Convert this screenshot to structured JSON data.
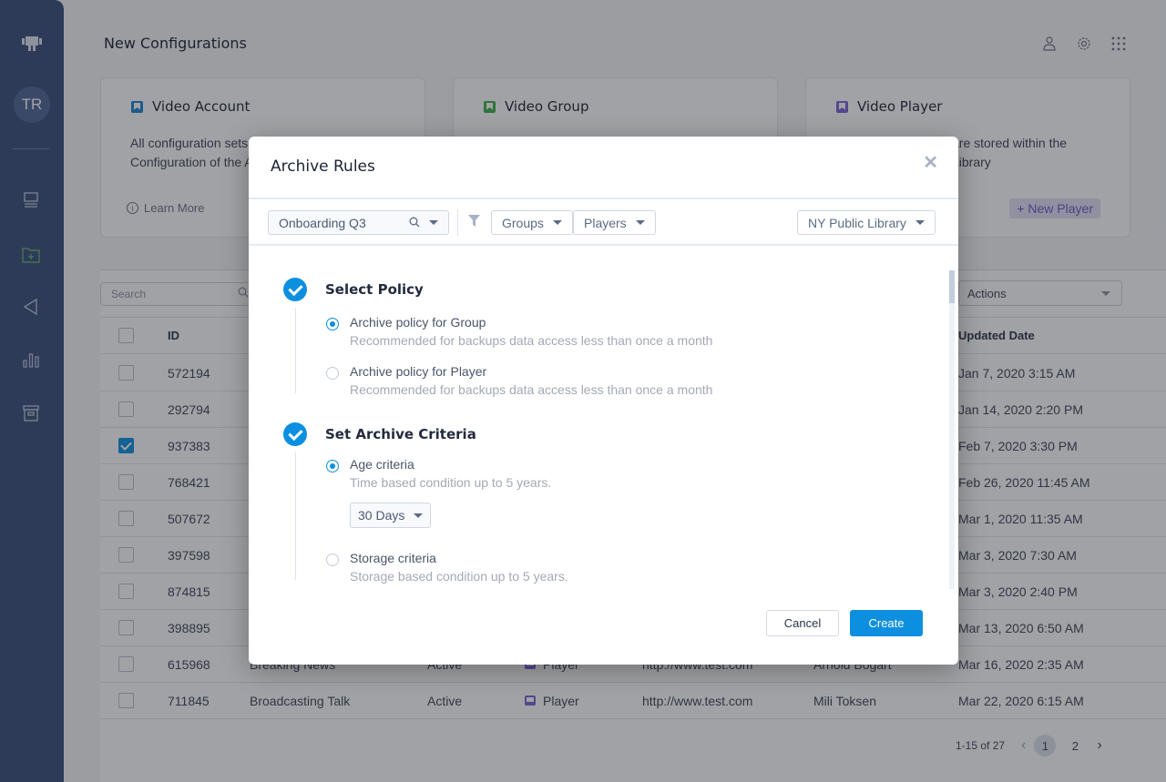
{
  "sidebar": {
    "avatar_initials": "TR",
    "items": [
      {
        "icon": "server-icon"
      },
      {
        "icon": "folder-add-icon"
      },
      {
        "icon": "send-icon"
      },
      {
        "icon": "bar-chart-icon"
      },
      {
        "icon": "archive-icon"
      }
    ]
  },
  "header": {
    "title": "New Configurations",
    "icons": [
      "user-icon",
      "gear-icon",
      "apps-grid-icon"
    ]
  },
  "cards": [
    {
      "title": "Video Account",
      "color": "#1a86d0",
      "desc_line1": "All configuration sets",
      "desc_line2": "Configuration of the A",
      "learn_more": "Learn More"
    },
    {
      "title": "Video Group",
      "color": "#3fae49"
    },
    {
      "title": "Video Player",
      "color": "#7c62d4",
      "desc_line1": "are stored within the",
      "desc_line2": "Library",
      "new_button": "+ New Player"
    }
  ],
  "table": {
    "search_placeholder": "Search",
    "actions_label": "Actions",
    "headers": {
      "id": "ID",
      "updated": "Updated Date"
    },
    "rows": [
      {
        "id": "572194",
        "checked": false,
        "name": "",
        "status": "",
        "type": "",
        "url": "",
        "owner": "",
        "updated": "Jan 7, 2020 3:15 AM"
      },
      {
        "id": "292794",
        "checked": false,
        "name": "",
        "status": "",
        "type": "",
        "url": "",
        "owner": "",
        "updated": "Jan 14, 2020 2:20 PM"
      },
      {
        "id": "937383",
        "checked": true,
        "name": "",
        "status": "",
        "type": "",
        "url": "",
        "owner": "",
        "updated": "Feb 7, 2020 3:30 PM"
      },
      {
        "id": "768421",
        "checked": false,
        "name": "",
        "status": "",
        "type": "",
        "url": "",
        "owner": "",
        "updated": "Feb 26, 2020 11:45 AM"
      },
      {
        "id": "507672",
        "checked": false,
        "name": "",
        "status": "",
        "type": "",
        "url": "",
        "owner": "",
        "updated": "Mar 1, 2020 11:35 AM"
      },
      {
        "id": "397598",
        "checked": false,
        "name": "",
        "status": "",
        "type": "",
        "url": "",
        "owner": "",
        "updated": "Mar 3, 2020 7:30 AM"
      },
      {
        "id": "874815",
        "checked": false,
        "name": "",
        "status": "",
        "type": "",
        "url": "",
        "owner": "",
        "updated": "Mar 3, 2020 2:40 PM"
      },
      {
        "id": "398895",
        "checked": false,
        "name": "",
        "status": "",
        "type": "",
        "url": "",
        "owner": "",
        "updated": "Mar 13, 2020 6:50 AM"
      },
      {
        "id": "615968",
        "checked": false,
        "name": "Breaking News",
        "status": "Active",
        "type": "Player",
        "url": "http://www.test.com",
        "owner": "Arnold Bogart",
        "updated": "Mar 16, 2020 2:35 AM"
      },
      {
        "id": "711845",
        "checked": false,
        "name": "Broadcasting Talk",
        "status": "Active",
        "type": "Player",
        "url": "http://www.test.com",
        "owner": "Mili Toksen",
        "updated": "Mar 22, 2020 6:15 AM"
      }
    ],
    "pagination": {
      "range": "1-15 of 27",
      "pages": [
        "1",
        "2"
      ],
      "current": "1"
    }
  },
  "modal": {
    "title": "Archive Rules",
    "close_icon": "close-icon",
    "toolbar": {
      "search_value": "Onboarding Q3",
      "groups_label": "Groups",
      "players_label": "Players",
      "library_label": "NY Public Library"
    },
    "steps": [
      {
        "title": "Select Policy",
        "options": [
          {
            "label": "Archive policy for Group",
            "sub": "Recommended for backups data access less than once a month",
            "selected": true
          },
          {
            "label": "Archive policy for Player",
            "sub": "Recommended for backups data access less than once a month",
            "selected": false
          }
        ]
      },
      {
        "title": "Set Archive Criteria",
        "options": [
          {
            "label": "Age criteria",
            "sub": "Time based condition up to 5 years.",
            "selected": true,
            "dropdown": "30 Days"
          },
          {
            "label": "Storage criteria",
            "sub": "Storage based condition up to 5 years.",
            "selected": false
          }
        ]
      }
    ],
    "cancel_label": "Cancel",
    "create_label": "Create"
  }
}
